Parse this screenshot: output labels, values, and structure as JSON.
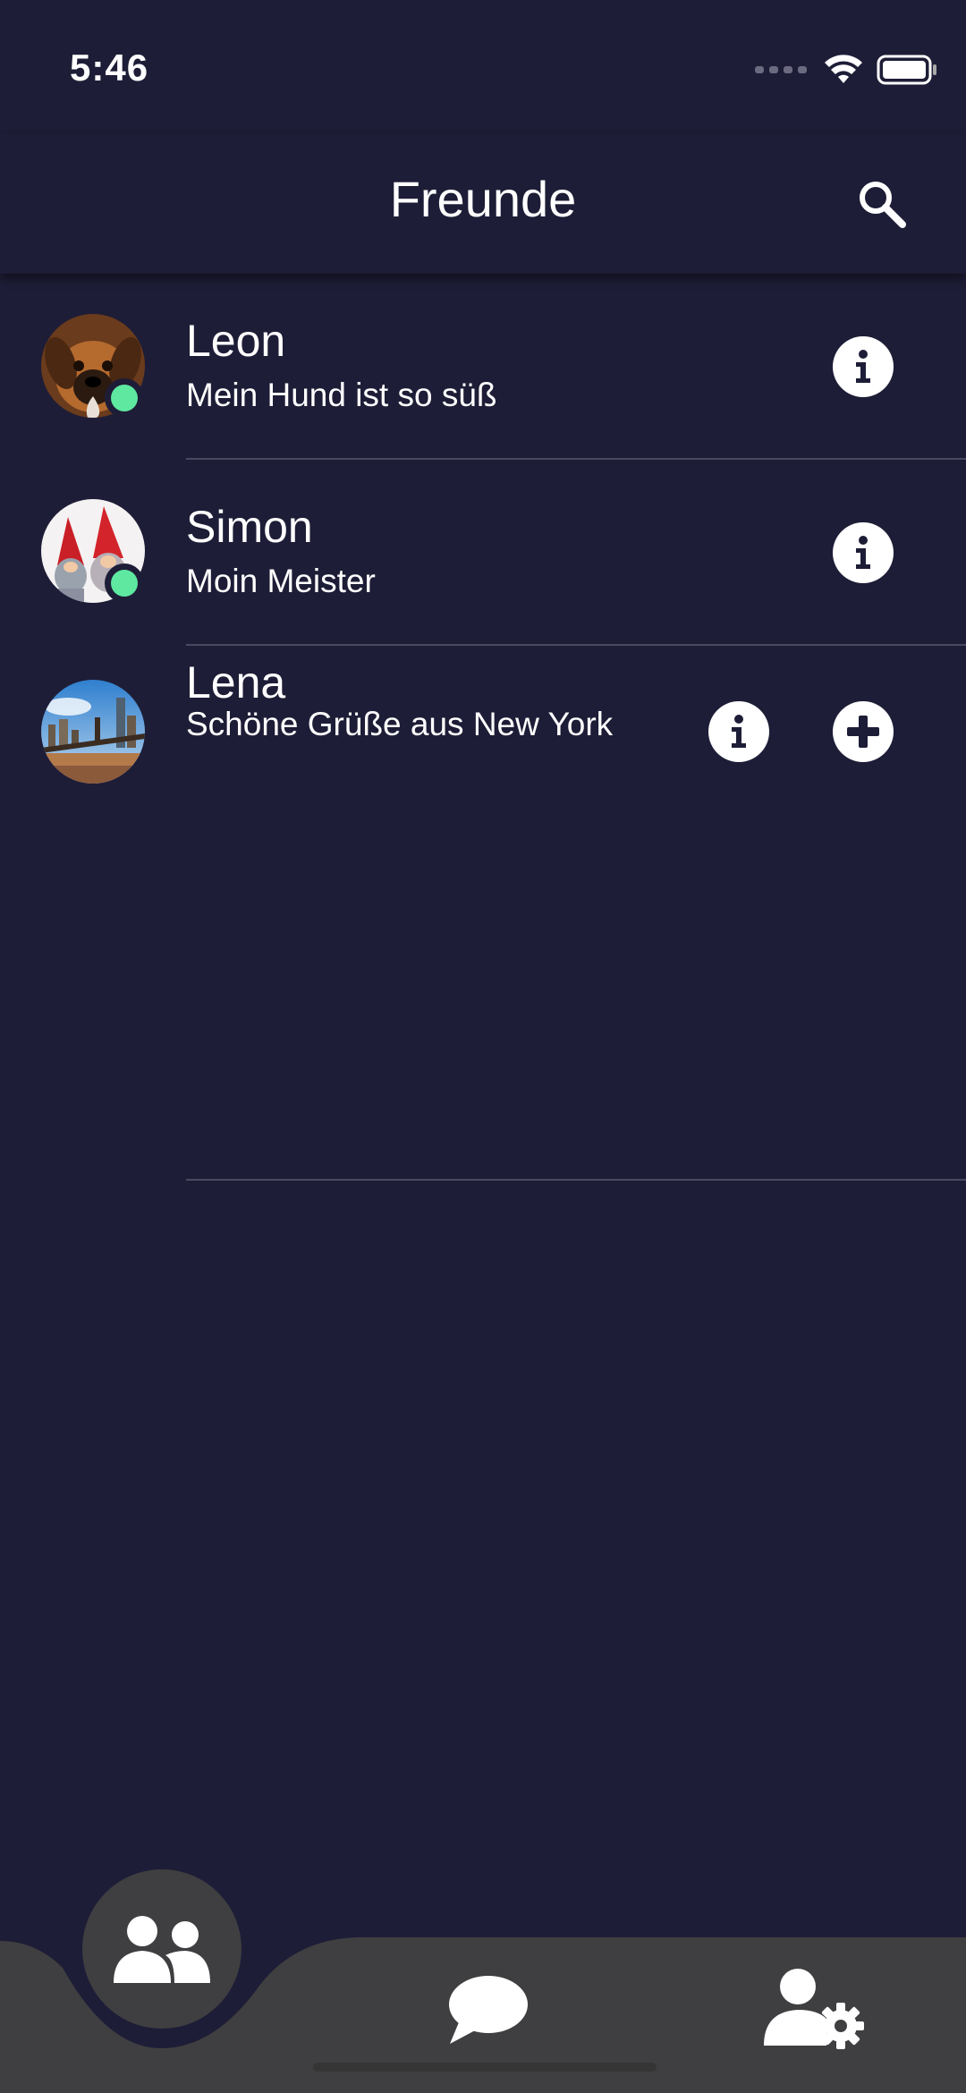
{
  "status_bar": {
    "time": "5:46"
  },
  "header": {
    "title": "Freunde",
    "search_icon": "search-icon"
  },
  "friends": [
    {
      "name": "Leon",
      "status": "Mein Hund ist so süß",
      "online": true,
      "avatar": "dog-photo",
      "actions": [
        "info-icon"
      ]
    },
    {
      "name": "Simon",
      "status": "Moin Meister",
      "online": true,
      "avatar": "gnome-figures-photo",
      "actions": [
        "info-icon"
      ]
    },
    {
      "name": "Lena",
      "status": "Schöne Grüße aus New York",
      "online": false,
      "avatar": "brooklyn-bridge-photo",
      "actions": [
        "info-icon",
        "add-icon"
      ]
    }
  ],
  "bottom_nav": {
    "items": [
      {
        "icon": "friends-icon",
        "active": true
      },
      {
        "icon": "chat-icon",
        "active": false
      },
      {
        "icon": "user-settings-icon",
        "active": false
      }
    ],
    "active_color": "#1e1d37",
    "bar_color": "#3f3f41"
  },
  "colors": {
    "background": "#1e1d37",
    "online": "#5ee8a0",
    "divider": "#4a4960"
  }
}
